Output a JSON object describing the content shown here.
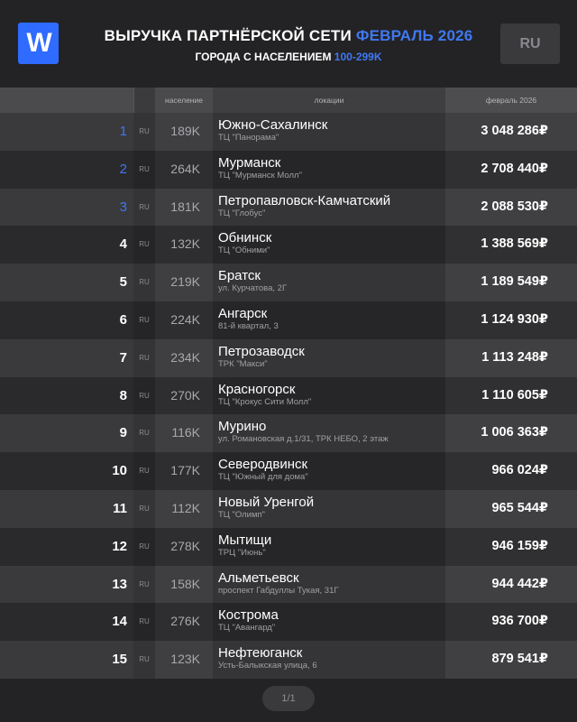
{
  "header": {
    "logo_text": "W",
    "title_main": "ВЫРУЧКА ПАРТНЁРСКОЙ СЕТИ",
    "title_period": "ФЕВРАЛЬ 2026",
    "subtitle_main": "ГОРОДА С НАСЕЛЕНИЕМ",
    "subtitle_range": "100-299K",
    "language_button": "RU",
    "accent_color": "#3f78f2"
  },
  "table": {
    "columns": {
      "rank": "",
      "country": "",
      "population": "население",
      "locations": "локации",
      "revenue": "февраль 2026"
    },
    "rows": [
      {
        "rank": "1",
        "country": "RU",
        "population": "189K",
        "city": "Южно-Сахалинск",
        "address": "ТЦ \"Панорама\"",
        "revenue": "3 048 286₽"
      },
      {
        "rank": "2",
        "country": "RU",
        "population": "264K",
        "city": "Мурманск",
        "address": "ТЦ \"Мурманск Молл\"",
        "revenue": "2 708 440₽"
      },
      {
        "rank": "3",
        "country": "RU",
        "population": "181K",
        "city": "Петропавловск-Камчатский",
        "address": "ТЦ \"Глобус\"",
        "revenue": "2 088 530₽"
      },
      {
        "rank": "4",
        "country": "RU",
        "population": "132K",
        "city": "Обнинск",
        "address": "ТЦ \"Обними\"",
        "revenue": "1 388 569₽"
      },
      {
        "rank": "5",
        "country": "RU",
        "population": "219K",
        "city": "Братск",
        "address": "ул. Курчатова, 2Г",
        "revenue": "1 189 549₽"
      },
      {
        "rank": "6",
        "country": "RU",
        "population": "224K",
        "city": "Ангарск",
        "address": "81-й квартал, 3",
        "revenue": "1 124 930₽"
      },
      {
        "rank": "7",
        "country": "RU",
        "population": "234K",
        "city": "Петрозаводск",
        "address": "ТРК \"Макси\"",
        "revenue": "1 113 248₽"
      },
      {
        "rank": "8",
        "country": "RU",
        "population": "270K",
        "city": "Красногорск",
        "address": "ТЦ \"Крокус Сити Молл\"",
        "revenue": "1 110 605₽"
      },
      {
        "rank": "9",
        "country": "RU",
        "population": "116K",
        "city": "Мурино",
        "address": "ул. Романовская д.1/31, ТРК НЕБО, 2 этаж",
        "revenue": "1 006 363₽"
      },
      {
        "rank": "10",
        "country": "RU",
        "population": "177K",
        "city": "Северодвинск",
        "address": "ТЦ \"Южный для дома\"",
        "revenue": "966 024₽"
      },
      {
        "rank": "11",
        "country": "RU",
        "population": "112K",
        "city": "Новый Уренгой",
        "address": "ТЦ \"Олимп\"",
        "revenue": "965 544₽"
      },
      {
        "rank": "12",
        "country": "RU",
        "population": "278K",
        "city": "Мытищи",
        "address": "ТРЦ \"Июнь\"",
        "revenue": "946 159₽"
      },
      {
        "rank": "13",
        "country": "RU",
        "population": "158K",
        "city": "Альметьевск",
        "address": "проспект Габдуллы Тукая, 31Г",
        "revenue": "944 442₽"
      },
      {
        "rank": "14",
        "country": "RU",
        "population": "276K",
        "city": "Кострома",
        "address": "ТЦ \"Авангард\"",
        "revenue": "936 700₽"
      },
      {
        "rank": "15",
        "country": "RU",
        "population": "123K",
        "city": "Нефтеюганск",
        "address": "Усть-Балыкская улица, 6",
        "revenue": "879 541₽"
      }
    ]
  },
  "pager": {
    "label": "1/1"
  }
}
